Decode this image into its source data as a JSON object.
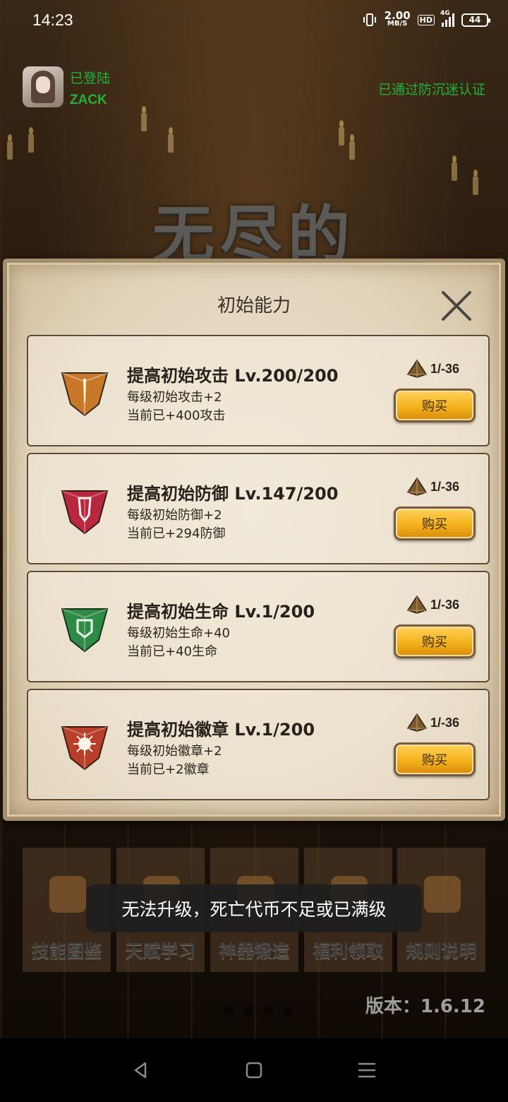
{
  "status_bar": {
    "time": "14:23",
    "speed_value": "2.00",
    "speed_unit": "MB/S",
    "hd": "HD",
    "network": "4G",
    "battery": "44"
  },
  "user": {
    "login_status": "已登陆",
    "username": "ZACK",
    "anti_addiction": "已通过防沉迷认证"
  },
  "game_title": "无尽的",
  "dialog": {
    "title": "初始能力",
    "items": [
      {
        "title": "提高初始攻击 Lv.200/200",
        "desc": "每级初始攻击+2",
        "current": "当前已+400攻击",
        "cost": "1/-36",
        "buy_label": "购买",
        "gem_color": "#c9782a"
      },
      {
        "title": "提高初始防御 Lv.147/200",
        "desc": "每级初始防御+2",
        "current": "当前已+294防御",
        "cost": "1/-36",
        "buy_label": "购买",
        "gem_color": "#b8283c"
      },
      {
        "title": "提高初始生命 Lv.1/200",
        "desc": "每级初始生命+40",
        "current": "当前已+40生命",
        "cost": "1/-36",
        "buy_label": "购买",
        "gem_color": "#2f8a45"
      },
      {
        "title": "提高初始徽章 Lv.1/200",
        "desc": "每级初始徽章+2",
        "current": "当前已+2徽章",
        "cost": "1/-36",
        "buy_label": "购买",
        "gem_color": "#b8402a"
      }
    ]
  },
  "menu": {
    "items": [
      {
        "label": "技能图鉴"
      },
      {
        "label": "天赋学习"
      },
      {
        "label": "神器锻造"
      },
      {
        "label": "福利领取"
      },
      {
        "label": "规则说明"
      }
    ]
  },
  "version": "版本：1.6.12",
  "toast": "无法升级，死亡代币不足或已满级"
}
